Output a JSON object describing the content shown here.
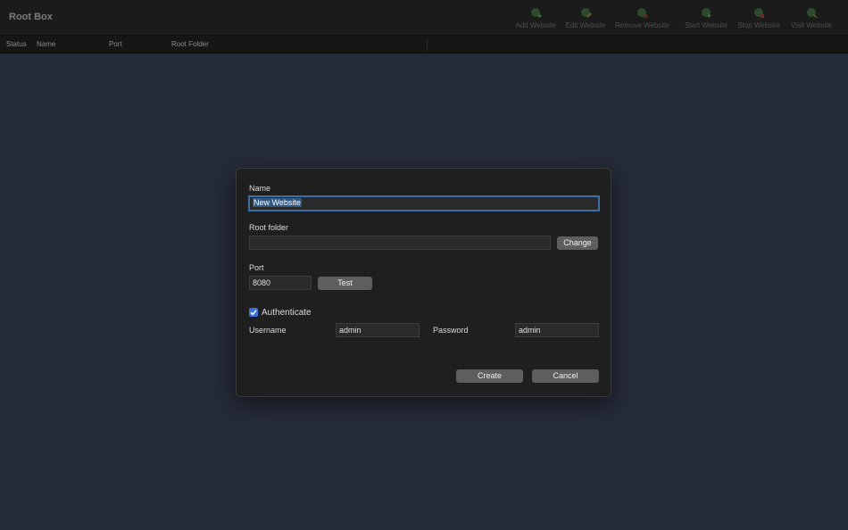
{
  "app": {
    "title": "Root Box"
  },
  "toolbar": {
    "buttons": [
      {
        "label": "Add Website",
        "icon": "globe-add-icon"
      },
      {
        "label": "Edit Website",
        "icon": "globe-edit-icon"
      },
      {
        "label": "Remove Website",
        "icon": "globe-remove-icon"
      },
      {
        "label": "Start Website",
        "icon": "globe-start-icon"
      },
      {
        "label": "Stop Website",
        "icon": "globe-stop-icon"
      },
      {
        "label": "Visit Website",
        "icon": "globe-visit-icon"
      }
    ]
  },
  "table": {
    "columns": [
      "Status",
      "Name",
      "Port",
      "Root Folder"
    ]
  },
  "dialog": {
    "name_label": "Name",
    "name_value": "New Website",
    "root_folder_label": "Root folder",
    "root_folder_value": "",
    "change_button": "Change",
    "port_label": "Port",
    "port_value": "8080",
    "test_button": "Test",
    "authenticate_label": "Authenticate",
    "authenticate_checked": true,
    "username_label": "Username",
    "username_value": "admin",
    "password_label": "Password",
    "password_value": "admin",
    "create_button": "Create",
    "cancel_button": "Cancel"
  },
  "colors": {
    "background": "#262b39",
    "checkbox_accent": "#3a6fd8",
    "focus_ring": "#3d6ea8"
  }
}
